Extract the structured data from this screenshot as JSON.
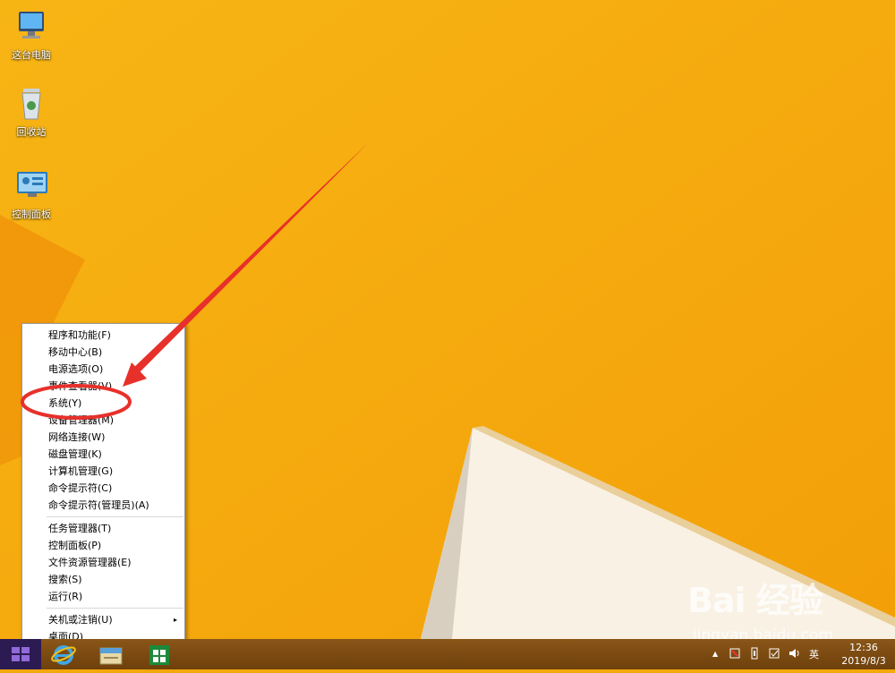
{
  "desktop": {
    "icons": [
      {
        "label": "这台电脑",
        "icon": "computer-icon"
      },
      {
        "label": "回收站",
        "icon": "recycle-bin-icon"
      },
      {
        "label": "控制面板",
        "icon": "control-panel-icon"
      }
    ]
  },
  "context_menu": {
    "group1": [
      "程序和功能(F)",
      "移动中心(B)",
      "电源选项(O)",
      "事件查看器(V)",
      "系统(Y)",
      "设备管理器(M)",
      "网络连接(W)",
      "磁盘管理(K)",
      "计算机管理(G)",
      "命令提示符(C)",
      "命令提示符(管理员)(A)"
    ],
    "group2": [
      "任务管理器(T)",
      "控制面板(P)",
      "文件资源管理器(E)",
      "搜索(S)",
      "运行(R)"
    ],
    "group3": [
      "关机或注销(U)",
      "桌面(D)"
    ],
    "submenu_arrow": "▸"
  },
  "taskbar": {
    "start_icon": "windows-logo-icon",
    "pinned": [
      "internet-explorer-icon",
      "file-explorer-icon",
      "store-icon"
    ],
    "tray": {
      "ime": "英",
      "show_hidden": "▲",
      "time": "12:36",
      "date": "2019/8/3"
    }
  },
  "watermark": {
    "brand": "Bai 经验",
    "url": "jingyan.baidu.com"
  },
  "colors": {
    "wallpaper": "#f5a80c",
    "annotation": "#e8302a",
    "start": "#2c1a52"
  }
}
